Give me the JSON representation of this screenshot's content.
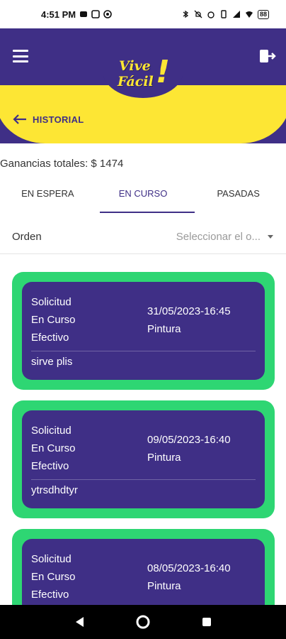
{
  "statusbar": {
    "time": "4:51 PM",
    "battery": "88"
  },
  "header": {
    "logo_line1": "Vive",
    "logo_line2": "Fácil",
    "logo_mark": "!",
    "back_label": "HISTORIAL",
    "icons": {
      "menu": "menu-icon",
      "logout": "logout-icon",
      "back": "arrow-left-icon"
    }
  },
  "summary": {
    "ganancias": "Ganancias totales: $ 1474"
  },
  "tabs": [
    {
      "label": "EN ESPERA"
    },
    {
      "label": "EN CURSO"
    },
    {
      "label": "PASADAS"
    }
  ],
  "filter": {
    "label": "Orden",
    "placeholder": "Seleccionar el o..."
  },
  "cards": [
    {
      "line1": "Solicitud",
      "line2": "En Curso",
      "line3": "Efectivo",
      "date": "31/05/2023-16:45",
      "service": "Pintura",
      "desc": "sirve plis"
    },
    {
      "line1": "Solicitud",
      "line2": "En Curso",
      "line3": "Efectivo",
      "date": "09/05/2023-16:40",
      "service": "Pintura",
      "desc": "ytrsdhdtyr"
    },
    {
      "line1": "Solicitud",
      "line2": "En Curso",
      "line3": "Efectivo",
      "date": "08/05/2023-16:40",
      "service": "Pintura",
      "desc": ""
    }
  ],
  "colors": {
    "primary": "#3f2f86",
    "accent": "#fde634",
    "card_border": "#2ed673"
  }
}
